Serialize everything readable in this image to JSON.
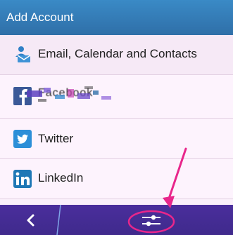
{
  "header": {
    "title": "Add Account"
  },
  "accounts": [
    {
      "label": "Email, Calendar and Contacts",
      "icon": "person-mail-icon"
    },
    {
      "label": "Facebook",
      "icon": "facebook-icon"
    },
    {
      "label": "Twitter",
      "icon": "twitter-icon"
    },
    {
      "label": "LinkedIn",
      "icon": "linkedin-icon"
    }
  ],
  "footer": {
    "back_icon": "chevron-left-icon",
    "settings_icon": "sliders-icon"
  },
  "colors": {
    "header": "#3a8ac6",
    "footer": "#4a2e9c",
    "accent_annotation": "#e8268b",
    "twitter": "#2c8fd8",
    "linkedin": "#1f78b6"
  }
}
